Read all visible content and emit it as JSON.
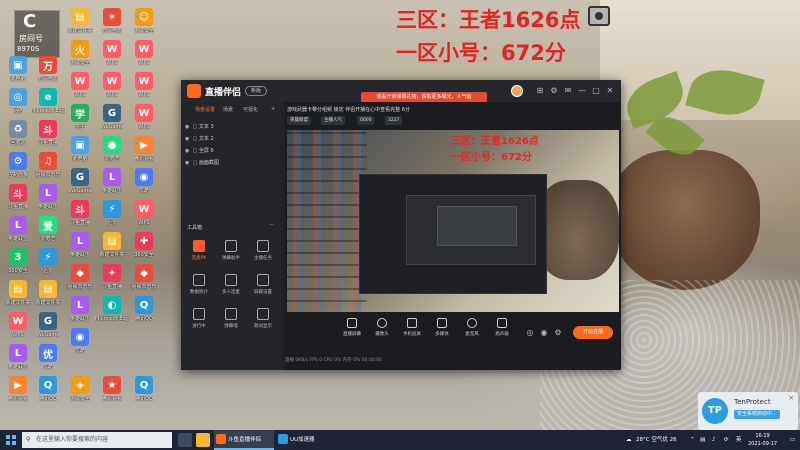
{
  "overlay": {
    "line1": "三区：王者1626点",
    "line2": "一区小号：672分"
  },
  "room_badge": {
    "char": "C",
    "title": "房间号",
    "number": "8970S"
  },
  "desktop_icons": [
    {
      "label": "此电脑",
      "color": "#4aa3df"
    },
    {
      "label": "万兴喵影",
      "color": "#e74c3c"
    },
    {
      "label": "火绒安全",
      "color": "#f39c12"
    },
    {
      "label": "学生",
      "color": "#27ae60"
    },
    {
      "label": "WeGame",
      "color": "#3c6382"
    },
    {
      "label": "腾讯QQ",
      "color": "#2d98da"
    },
    {
      "label": "网络",
      "color": "#4aa3df"
    },
    {
      "label": "Microsoft Edge",
      "color": "#0fb9b1"
    },
    {
      "label": "新建文件夹",
      "color": "#f7b731"
    },
    {
      "label": "回收站",
      "color": "#778ca3"
    },
    {
      "label": "斗鱼直播",
      "color": "#eb3b5a"
    },
    {
      "label": "控制面板",
      "color": "#4b7bec"
    },
    {
      "label": "网易云音乐",
      "color": "#e74c3c"
    },
    {
      "label": "英雄联盟",
      "color": "#a55eea"
    },
    {
      "label": "WPS",
      "color": "#fc5c65"
    },
    {
      "label": "爱奇艺",
      "color": "#26de81"
    },
    {
      "label": "迅雷",
      "color": "#2d98da"
    },
    {
      "label": "360安全",
      "color": "#20bf6b"
    },
    {
      "label": "优酷",
      "color": "#4b7bec"
    },
    {
      "label": "腾讯视频",
      "color": "#fa8231"
    }
  ],
  "app": {
    "logo": "直播伴侣",
    "version_btn": "新版",
    "notice": "观看开启弹幕礼物，获取更多曝光，人气值",
    "left_tabs": [
      "场景设置",
      "场景",
      "可视化"
    ],
    "scenes": [
      "文本 3",
      "文本 2",
      "全屏 6",
      "画面截图"
    ],
    "tools_title": "工具箱",
    "tools": [
      {
        "label": "连麦PK",
        "hot": true
      },
      {
        "label": "弹幕助手",
        "hot": false
      },
      {
        "label": "主播任务",
        "hot": false
      },
      {
        "label": "数据统计",
        "hot": false
      },
      {
        "label": "多人连麦",
        "hot": false
      },
      {
        "label": "屏蔽设置",
        "hot": false
      },
      {
        "label": "进行中",
        "hot": false
      },
      {
        "label": "弹幕墙",
        "hot": false
      },
      {
        "label": "歌词显示",
        "hot": false
      }
    ],
    "stream_info": "游戏武器卡带分组频   锁定   伴侣开播在心中查看完整   6分",
    "chips": [
      "英雄联盟",
      "主播人气",
      "0000",
      "3227"
    ],
    "preview_line1": "三区：王者1626点",
    "preview_line2": "一区小号：672分",
    "bottom_buttons": [
      "直播屏幕",
      "摄像头",
      "手机投屏",
      "多媒体",
      "麦克风",
      "扬声器"
    ],
    "start_button": "开始直播",
    "status": "直播 0KB/s   FPS 0   CPU 0%   内存 0%   00:00:00"
  },
  "tenprotect": {
    "logo": "TP",
    "name": "TenProtect",
    "status": "安全系统启动中..."
  },
  "taskbar": {
    "search_placeholder": "在这里输入你要搜索的内容",
    "apps": [
      "斗鱼直播伴侣",
      "UU加速器"
    ],
    "weather": "28°C  空气优 26",
    "lang": "英",
    "time": "16:19",
    "date": "2021-09-17"
  }
}
